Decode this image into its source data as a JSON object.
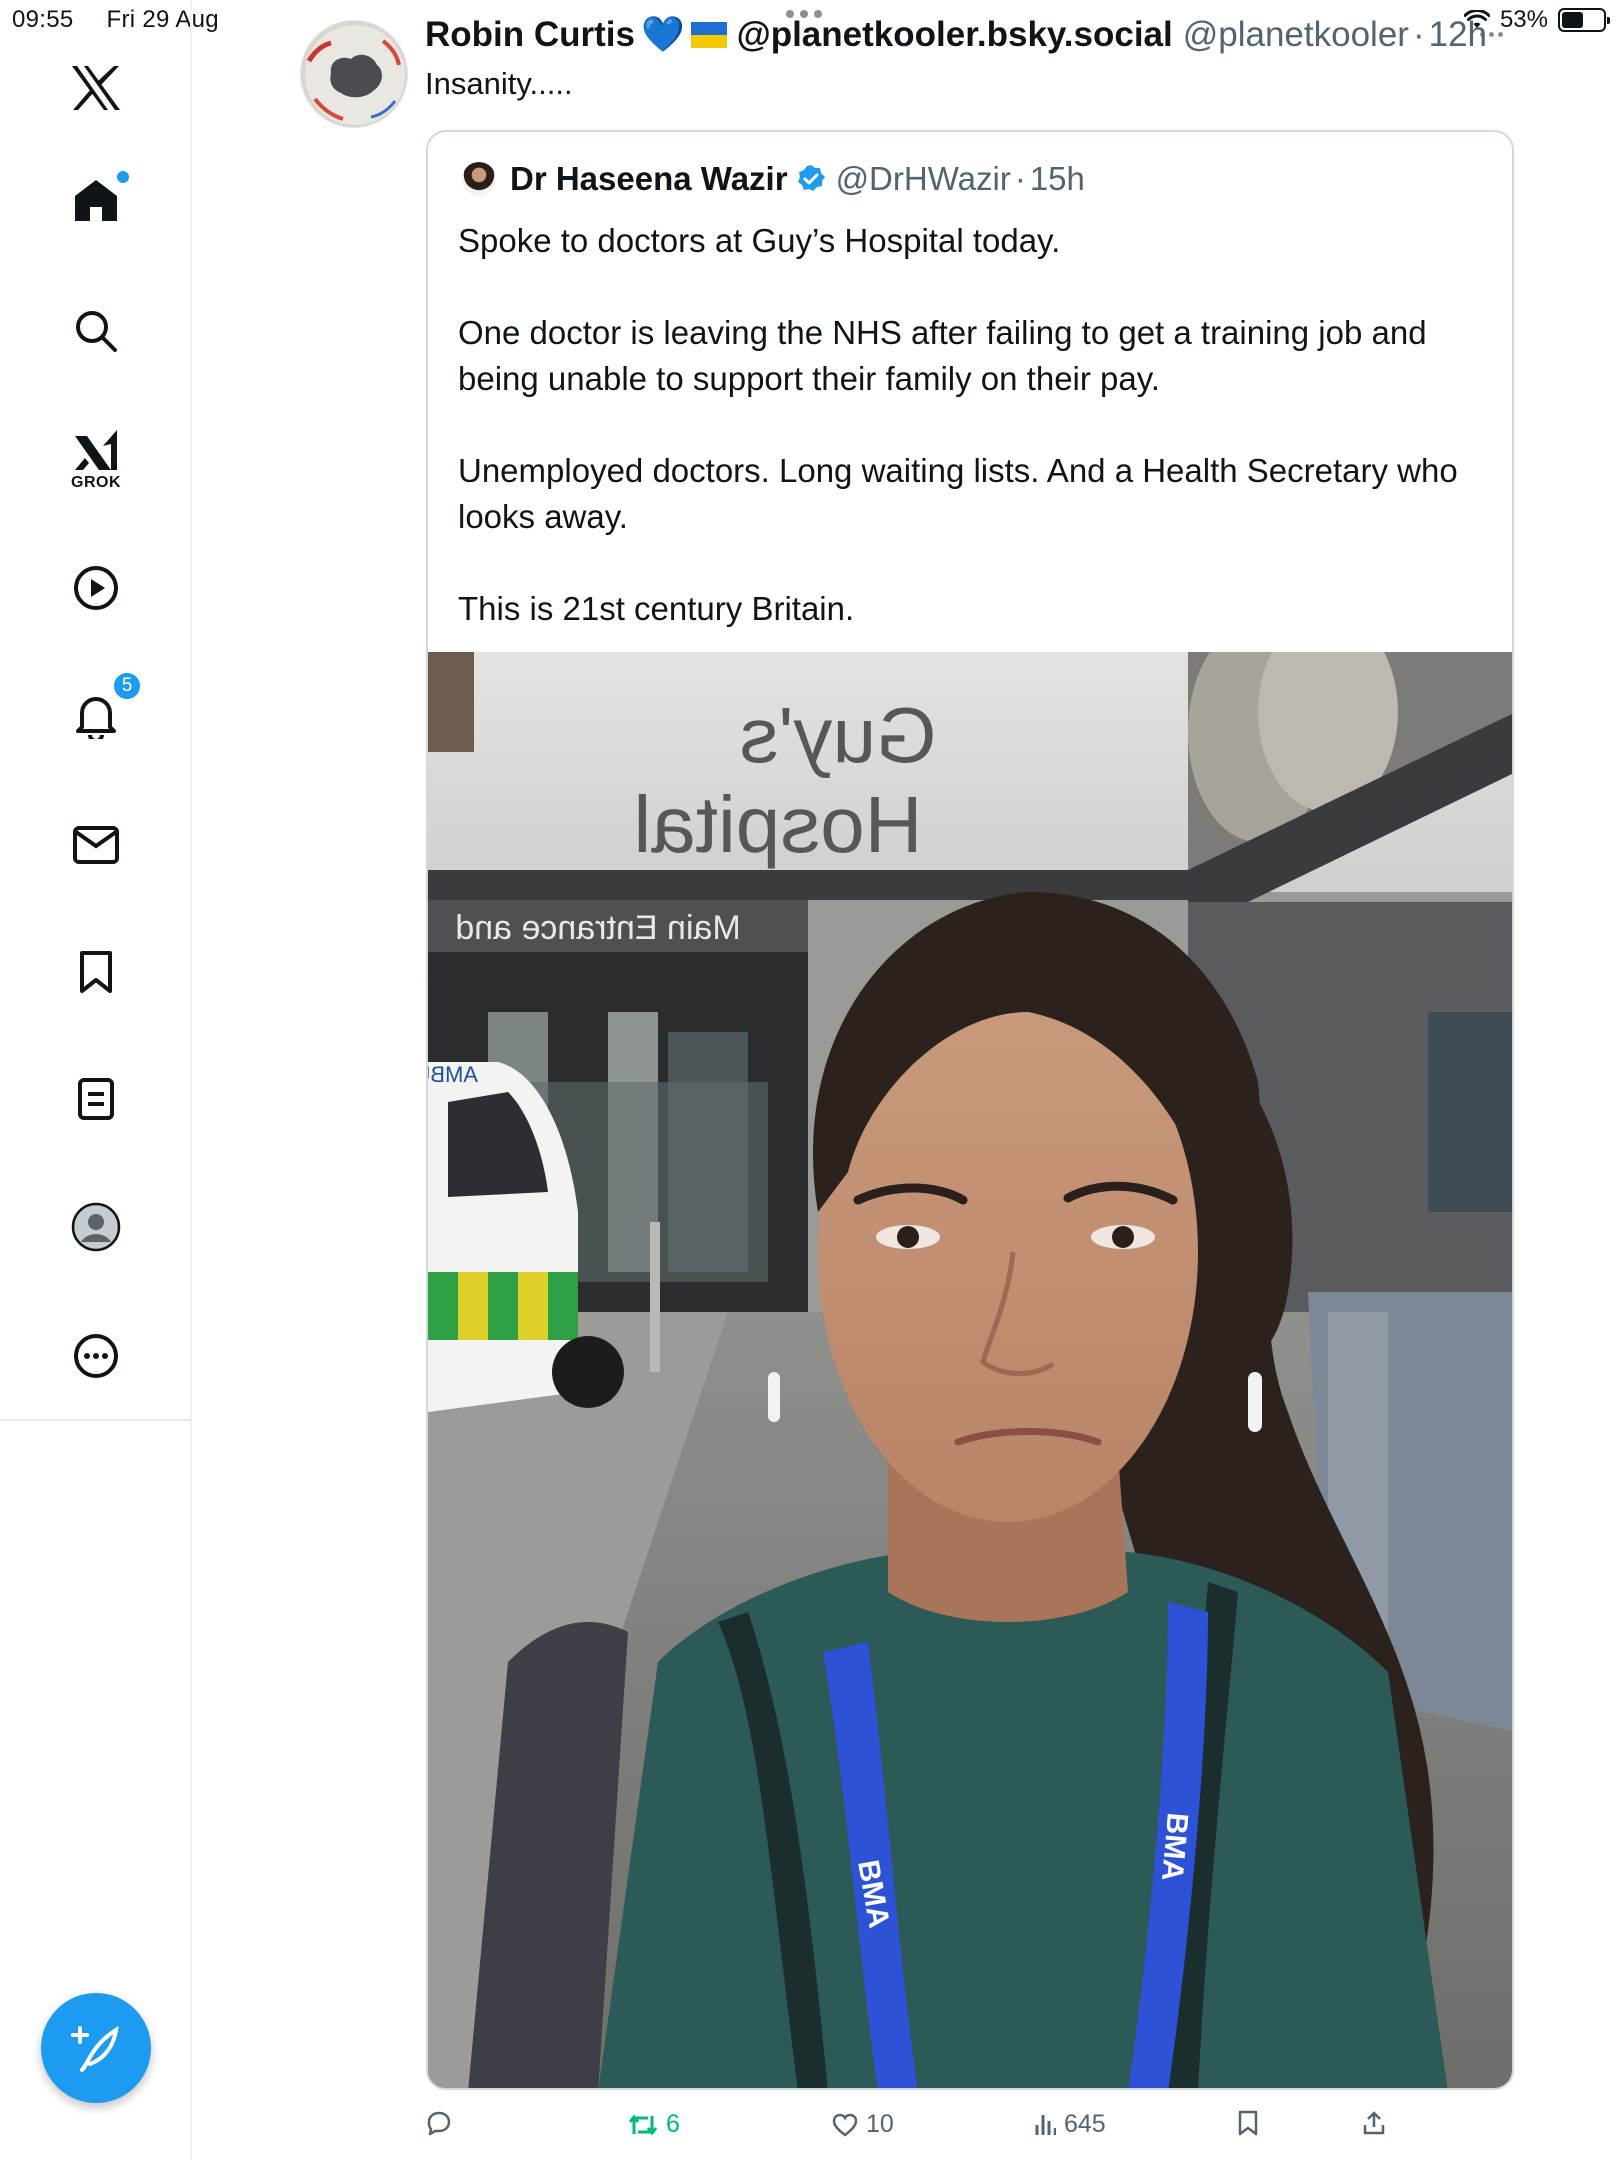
{
  "status_bar": {
    "time": "09:55",
    "date": "Fri 29 Aug",
    "battery_percent": "53%",
    "battery_level": 0.53
  },
  "sidebar": {
    "items": [
      {
        "name": "x-logo",
        "label": ""
      },
      {
        "name": "home",
        "label": ""
      },
      {
        "name": "search",
        "label": ""
      },
      {
        "name": "grok",
        "label": "GROK"
      },
      {
        "name": "video",
        "label": ""
      },
      {
        "name": "notifications",
        "label": "",
        "badge": "5"
      },
      {
        "name": "messages",
        "label": ""
      },
      {
        "name": "bookmarks",
        "label": ""
      },
      {
        "name": "lists",
        "label": ""
      },
      {
        "name": "profile",
        "label": ""
      },
      {
        "name": "more",
        "label": ""
      }
    ],
    "compose_icon": "feather-plus-icon"
  },
  "tweet": {
    "author_name": "Robin Curtis",
    "author_emoji": "💙",
    "author_flag": "ukraine-flag",
    "author_bluesky": "@planetkooler.bsky.social",
    "author_handle": "@planetkooler",
    "separator": "·",
    "time": "12h",
    "text": "Insanity.....",
    "quote": {
      "name": "Dr Haseena Wazir",
      "verified": true,
      "handle": "@DrHWazir",
      "separator": "·",
      "time": "15h",
      "paragraphs": [
        "Spoke to doctors at Guy’s Hospital today.",
        "One doctor is leaving the NHS after failing to get a training job and being unable to support their family on their pay.",
        "Unemployed doctors. Long waiting lists. And a Health Secretary who looks away.",
        "This is 21st century Britain."
      ],
      "photo": {
        "sign_line1": "Guy's",
        "sign_line2": "Hospital",
        "entrance_sign": "Main Entrance and",
        "ambulance_text": "AMBULANCE",
        "lanyard_text": "BMA"
      }
    },
    "actions": {
      "reply_count": "",
      "retweet_count": "6",
      "like_count": "10",
      "views_count": "645",
      "bookmark_count": "",
      "share_count": ""
    }
  },
  "colors": {
    "accent": "#1d9bf0",
    "retweet_green": "#00ba7c",
    "muted_text": "#536471",
    "lanyard_blue": "#2d52d6"
  }
}
